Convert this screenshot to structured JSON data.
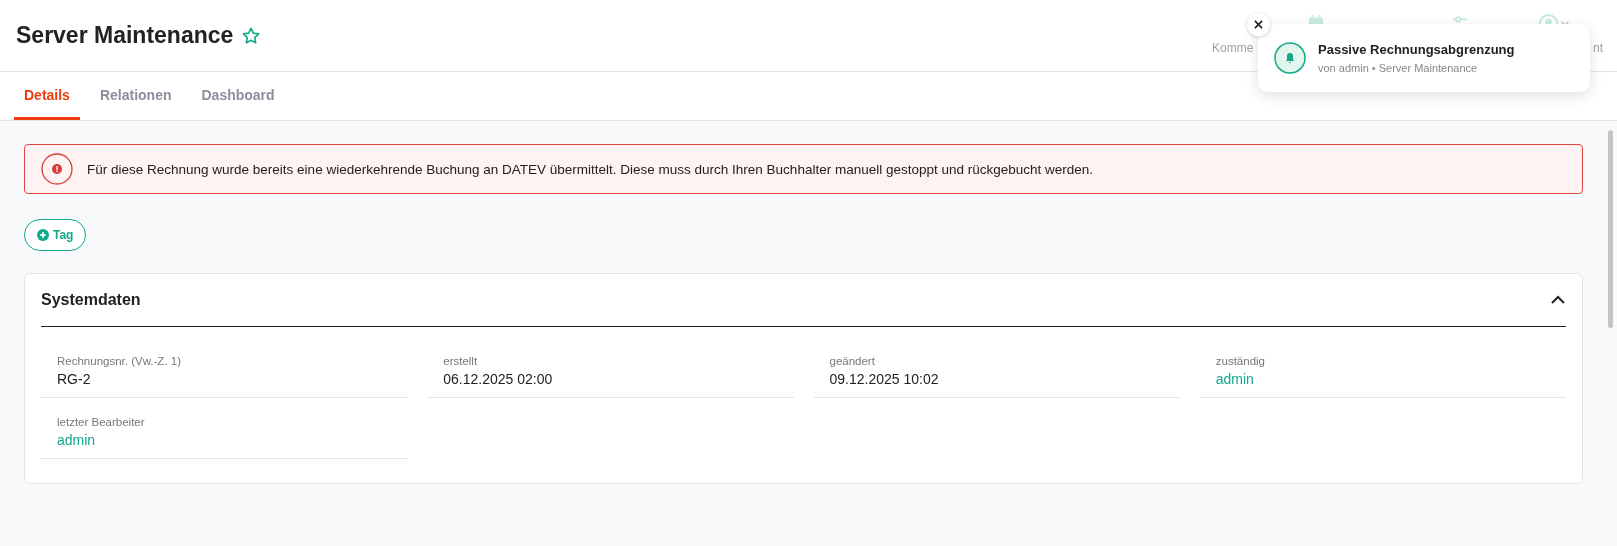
{
  "header": {
    "title": "Server Maintenance",
    "favorite": false,
    "toolbar": [
      {
        "kind": "label",
        "text": "Komme"
      },
      {
        "kind": "label",
        "text": "nt"
      }
    ]
  },
  "tabs": [
    {
      "label": "Details",
      "selected": true
    },
    {
      "label": "Relationen",
      "selected": false
    },
    {
      "label": "Dashboard",
      "selected": false
    }
  ],
  "alert": {
    "text": "Für diese Rechnung wurde bereits eine wiederkehrende Buchung an DATEV übermittelt. Diese muss durch Ihren Buchhalter manuell gestoppt und rückgebucht werden."
  },
  "tag_button": {
    "label": "Tag"
  },
  "section": {
    "title": "Systemdaten",
    "expanded": true,
    "fields": [
      {
        "label": "Rechnungsnr. (Vw.-Z. 1)",
        "value": "RG-2",
        "kind": "text"
      },
      {
        "label": "erstellt",
        "value": "06.12.2025 02:00",
        "kind": "text"
      },
      {
        "label": "geändert",
        "value": "09.12.2025 10:02",
        "kind": "text"
      },
      {
        "label": "zuständig",
        "value": "admin",
        "kind": "link"
      },
      {
        "label": "letzter Bearbeiter",
        "value": "admin",
        "kind": "link"
      }
    ]
  },
  "notification": {
    "title": "Passive Rechnungsabgrenzung",
    "subtitle": "von admin • Server Maintenance"
  }
}
